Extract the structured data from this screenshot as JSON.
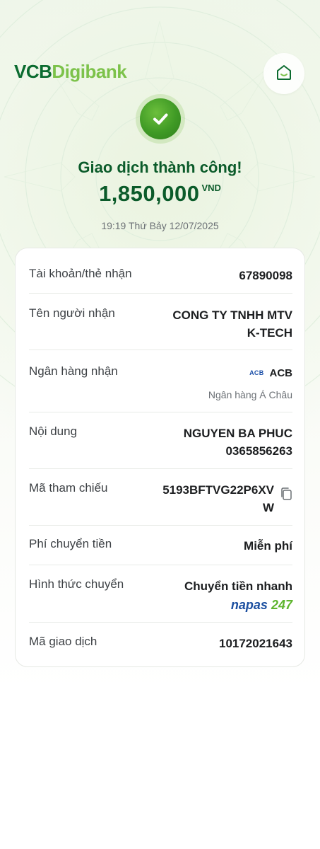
{
  "header": {
    "logo_vcb": "VCB",
    "logo_digi": "Digibank"
  },
  "status": {
    "title": "Giao dịch thành công!",
    "amount": "1,850,000",
    "currency": "VND",
    "datetime": "19:19 Thứ Bảy 12/07/2025"
  },
  "details": {
    "account_label": "Tài khoản/thẻ nhận",
    "account_value": "67890098",
    "recipient_label": "Tên người nhận",
    "recipient_line1": "CONG TY TNHH MTV",
    "recipient_line2": "K-TECH",
    "bank_label": "Ngân hàng nhận",
    "bank_logo": "ACB",
    "bank_code": "ACB",
    "bank_name": "Ngân hàng Á Châu",
    "content_label": "Nội dung",
    "content_line1": "NGUYEN BA PHUC",
    "content_line2": "0365856263",
    "ref_label": "Mã tham chiếu",
    "ref_line1": "5193BFTVG22P6XV",
    "ref_line2": "W",
    "fee_label": "Phí chuyển tiền",
    "fee_value": "Miễn phí",
    "method_label": "Hình thức chuyển",
    "method_value": "Chuyển tiền nhanh",
    "napas_text": "napas",
    "napas_num": "247",
    "txn_label": "Mã giao dịch",
    "txn_value": "10172021643"
  },
  "colors": {
    "brand_dark": "#0b5b2a",
    "brand_light": "#7cc24a",
    "napas_blue": "#1c4fa0"
  },
  "icons": {
    "home": "home-icon",
    "success": "check-icon",
    "copy": "copy-icon"
  }
}
